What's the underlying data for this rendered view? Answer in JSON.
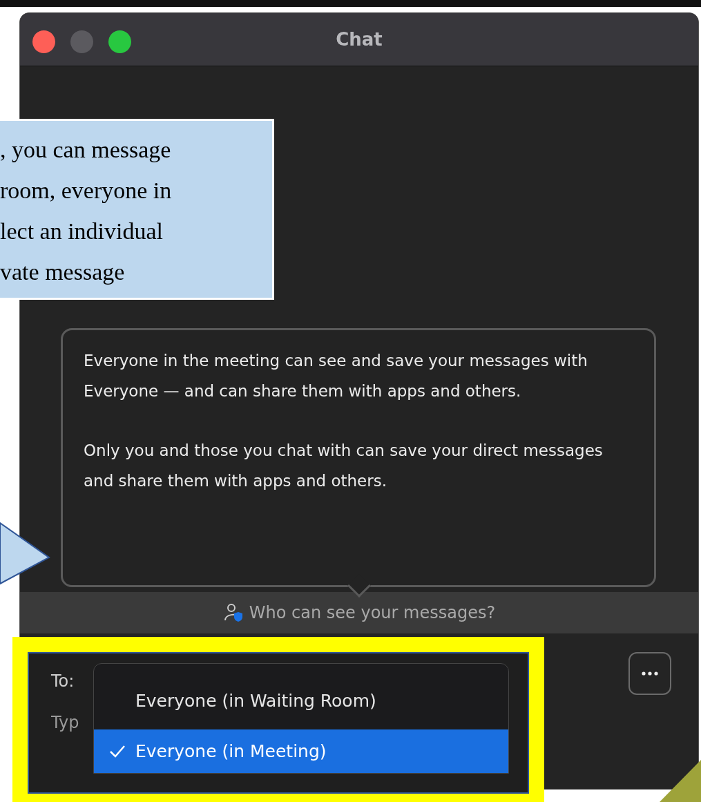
{
  "window": {
    "title": "Chat"
  },
  "callout": {
    "lines": [
      ", you can message",
      "room, everyone in",
      "lect an individual",
      "vate message"
    ]
  },
  "tooltip": {
    "paragraphs": [
      "Everyone in the meeting can see and save your messages with Everyone — and can share them with apps and others.",
      "Only you and those you chat with can save your direct messages and share them with apps and others."
    ]
  },
  "privacy_bar": {
    "label": "Who can see your messages?"
  },
  "composer": {
    "to_label": "To:",
    "placeholder": "Typ"
  },
  "recipient_menu": [
    {
      "label": "Everyone (in Waiting Room)",
      "selected": false
    },
    {
      "label": "Everyone (in Meeting)",
      "selected": true
    }
  ]
}
